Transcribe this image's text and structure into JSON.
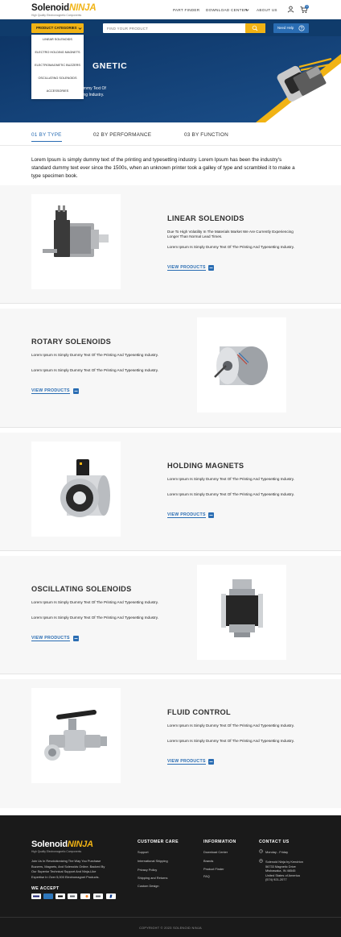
{
  "brand": {
    "name_a": "Solenoid",
    "name_b": "NINJA",
    "tagline": "High Quality Electromagnetic Components"
  },
  "header": {
    "links": [
      "PART FINDER",
      "DOWNLOAD CENTER",
      "ABOUT US"
    ],
    "cart_count": "0"
  },
  "navbar": {
    "categories_label": "PRODUCT CATEGORIES",
    "search_placeholder": "FIND YOUR PRODUCT",
    "help_label": "Need Help"
  },
  "dropdown": {
    "items": [
      "LINEAR SOLENOIDS",
      "ELECTRO HOLDING MAGNETS",
      "ELECTROMAGNETIC BUZZERS",
      "OSCILLATING SOLENOIDS",
      "ACCESSORIES"
    ]
  },
  "hero": {
    "title": "GNETIC",
    "text_line1": "ummy Text Of",
    "text_line2": "ting Industry."
  },
  "tabs": [
    "01 BY TYPE",
    "02 BY PERFORMANCE",
    "03 BY FUNCTION"
  ],
  "intro": "Lorem Ipsum is simply dummy text of the printing and typesetting industry. Lorem Ipsum has been the industry's standard dummy text ever since the 1500s, when an unknown printer took a galley of type and scrambled it to make a type specimen book.",
  "products": [
    {
      "title": "LINEAR SOLENOIDS",
      "p1": "Due To High Volatility In The Materials Market We Are Currently Experiencing Longer Than Normal Lead Times.",
      "p2": "Lorem Ipsum Is Simply Dummy Text Of The Printing And Typesetting Industry.",
      "cta": "VIEW PRODUCTS"
    },
    {
      "title": "ROTARY SOLENOIDS",
      "p1": "Lorem Ipsum Is Simply Dummy Text Of The Printing And Typesetting Industry.",
      "p2": "Lorem Ipsum Is Simply Dummy Text Of The Printing And Typesetting Industry.",
      "cta": "VIEW PRODUCTS"
    },
    {
      "title": "HOLDING MAGNETS",
      "p1": "Lorem Ipsum Is Simply Dummy Text Of The Printing And Typesetting Industry.",
      "p2": "Lorem Ipsum Is Simply Dummy Text Of The Printing And Typesetting Industry.",
      "cta": "VIEW PRODUCTS"
    },
    {
      "title": "OSCILLATING SOLENOIDS",
      "p1": "Lorem Ipsum Is Simply Dummy Text Of The Printing And Typesetting Industry.",
      "p2": "Lorem Ipsum Is Simply Dummy Text Of The Printing And Typesetting Industry.",
      "cta": "VIEW PRODUCTS"
    },
    {
      "title": "FLUID CONTROL",
      "p1": "Lorem Ipsum Is Simply Dummy Text Of The Printing And Typesetting Industry.",
      "p2": "Lorem Ipsum Is Simply Dummy Text Of The Printing And Typesetting Industry.",
      "cta": "VIEW PRODUCTS"
    }
  ],
  "footer": {
    "about": [
      "Join Us In Revolutionizing The Way You Purchase",
      "Buzzers, Magnets, And Solenoids Online. Backed By",
      "Our Superior Technical Support And Ninja-Like",
      "Expertise In Over 5,000 Electromagnet Products."
    ],
    "we_accept": "WE ACCEPT",
    "payments": [
      "VISA",
      "AMEX",
      "Apple Pay",
      "G Pay",
      "DISCOVER",
      "G Pay",
      "PayPal"
    ],
    "customer_care": {
      "heading": "CUSTOMER CARE",
      "links": [
        "Support",
        "International Shipping",
        "Privacy Policy",
        "Shipping and Returns",
        "Custom Design"
      ]
    },
    "information": {
      "heading": "INFORMATION",
      "links": [
        "Download Center",
        "Brands",
        "Product Finder",
        "FAQ"
      ]
    },
    "contact": {
      "heading": "CONTACT US",
      "hours": "Monday - Friday",
      "address": [
        "Solenoid Ninja by Kendrion",
        "56733 Magnetic Drive",
        "Mishawaka, IN 46545",
        "United States of America",
        "(574) 921-2077"
      ]
    },
    "copyright": "COPYRIGHT © 2023 SOLENOID NINJA"
  },
  "colors": {
    "navy": "#0f3b6b",
    "yellow": "#f1b314",
    "blue": "#2a6db3",
    "footer": "#1a1a1a"
  }
}
